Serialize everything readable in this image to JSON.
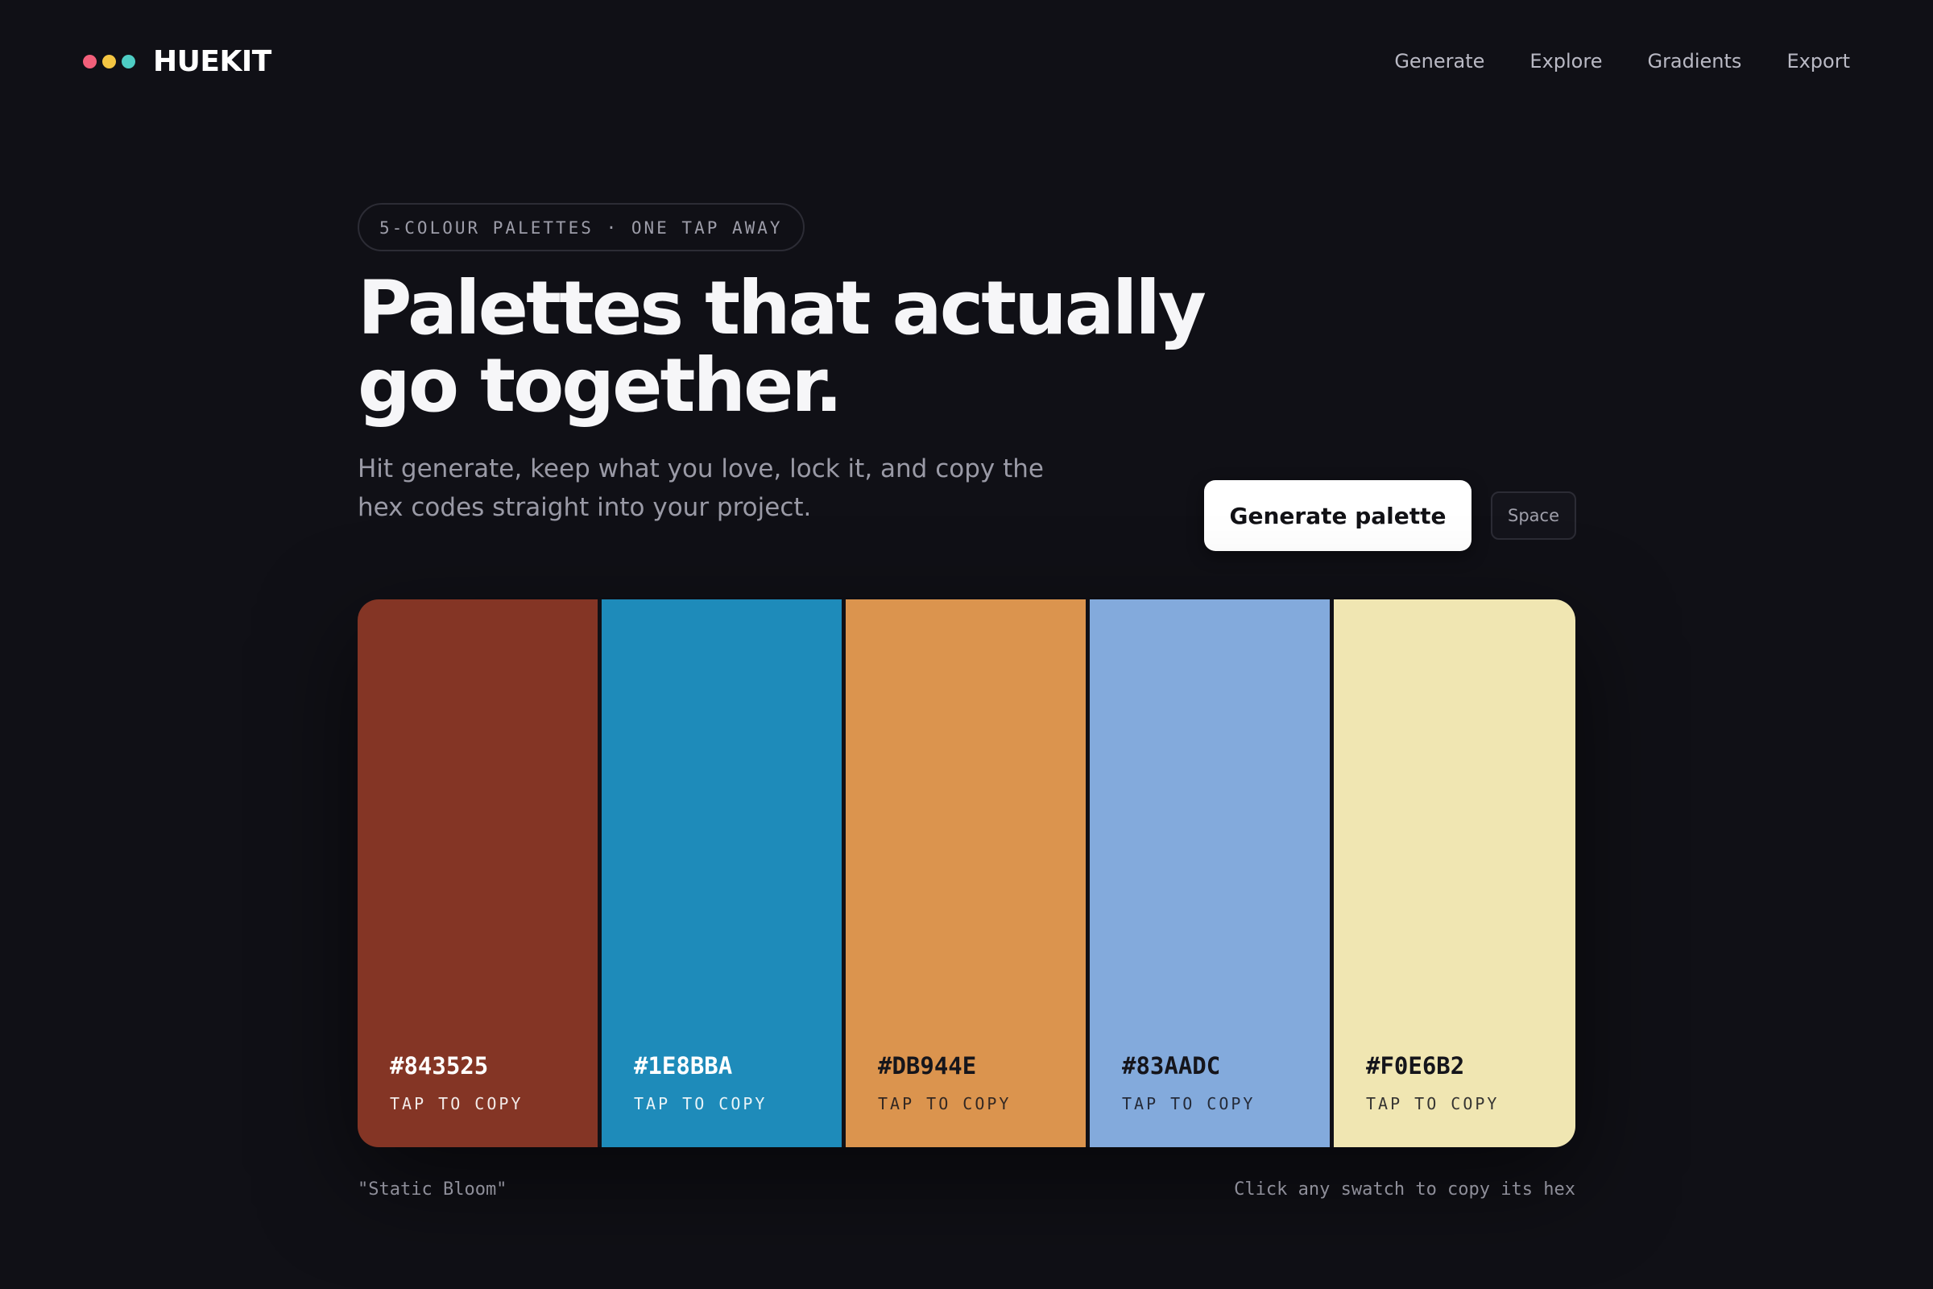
{
  "header": {
    "logo_text": "HUEKIT",
    "logo_dots": [
      "#f25f7a",
      "#f4c542",
      "#4ecdc4"
    ],
    "nav": [
      "Generate",
      "Explore",
      "Gradients",
      "Export"
    ]
  },
  "hero": {
    "badge": "5-COLOUR PALETTES · ONE TAP AWAY",
    "headline_line1": "Palettes that actually",
    "headline_line2": "go together.",
    "subtitle_line1": "Hit generate, keep what you love, lock it, and copy the",
    "subtitle_line2": "hex codes straight into your project.",
    "generate_label": "Generate palette",
    "shortcut_label": "Space"
  },
  "palette": {
    "name": "\"Static Bloom\"",
    "hint": "Click any swatch to copy its hex",
    "copy_label": "TAP TO COPY",
    "swatches": [
      {
        "hex": "#843525",
        "text_tone": "light"
      },
      {
        "hex": "#1E8BBA",
        "text_tone": "light"
      },
      {
        "hex": "#DB944E",
        "text_tone": "dark"
      },
      {
        "hex": "#83AADC",
        "text_tone": "dark"
      },
      {
        "hex": "#F0E6B2",
        "text_tone": "dark"
      }
    ]
  }
}
